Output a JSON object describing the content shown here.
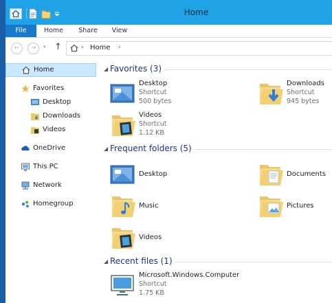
{
  "window": {
    "title": "Home"
  },
  "quick_access": {
    "icons": [
      "home-icon",
      "properties-icon",
      "new-folder-icon",
      "customize-dropdown-icon"
    ]
  },
  "ribbon": {
    "tabs": [
      "File",
      "Home",
      "Share",
      "View"
    ]
  },
  "address_bar": {
    "path": [
      "Home"
    ],
    "back": "←",
    "forward": "→",
    "up": "↑",
    "chevron": "›"
  },
  "nav_pane": {
    "home": "Home",
    "favorites": {
      "label": "Favorites",
      "items": [
        "Desktop",
        "Downloads",
        "Videos"
      ]
    },
    "onedrive": "OneDrive",
    "this_pc": "This PC",
    "network": "Network",
    "homegroup": "Homegroup"
  },
  "groups": [
    {
      "title": "Favorites (3)",
      "items": [
        {
          "name": "Desktop",
          "type": "Shortcut",
          "size": "500 bytes",
          "icon": "desktop-icon"
        },
        {
          "name": "Downloads",
          "type": "Shortcut",
          "size": "945 bytes",
          "icon": "downloads-folder-icon"
        },
        {
          "name": "Videos",
          "type": "Shortcut",
          "size": "1.12 KB",
          "icon": "videos-folder-icon"
        }
      ]
    },
    {
      "title": "Frequent folders (5)",
      "items": [
        {
          "name": "Desktop",
          "icon": "desktop-icon"
        },
        {
          "name": "Documents",
          "icon": "documents-folder-icon"
        },
        {
          "name": "Music",
          "icon": "music-folder-icon"
        },
        {
          "name": "Pictures",
          "icon": "pictures-folder-icon"
        },
        {
          "name": "Videos",
          "icon": "videos-folder-icon"
        }
      ]
    },
    {
      "title": "Recent files (1)",
      "items": [
        {
          "name": "Microsoft.Windows.Computer",
          "type": "Shortcut",
          "size": "1.75 KB",
          "icon": "computer-icon"
        }
      ]
    }
  ],
  "colors": {
    "titlebar": "#1fa3e6",
    "file_tab": "#1979ca",
    "group_title": "#1e3287",
    "selected_nav": "#cce8ff"
  }
}
